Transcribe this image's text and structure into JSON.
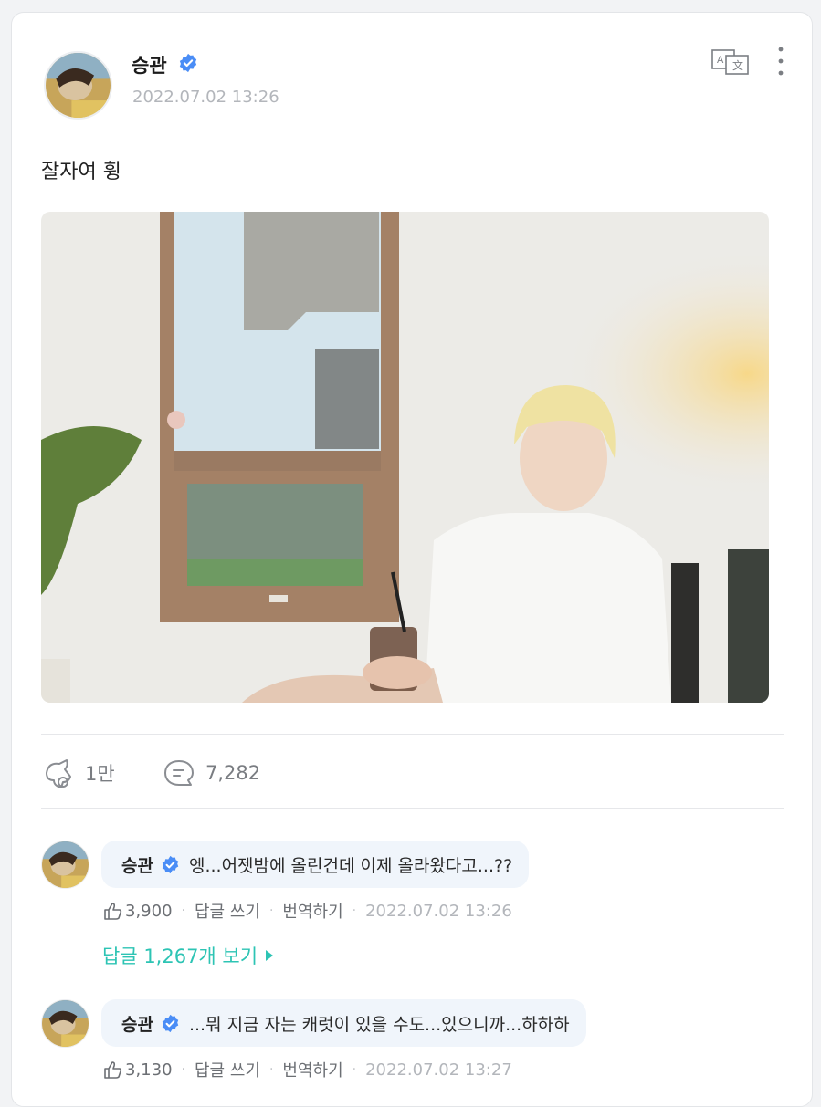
{
  "post": {
    "author": "승관",
    "date": "2022.07.02 13:26",
    "text": "잘자여 휭",
    "stats": {
      "likes": "1만",
      "comments": "7,282"
    }
  },
  "comments": [
    {
      "author": "승관",
      "text": "엥...어젯밤에 올린건데 이제 올라왔다고...??",
      "likes": "3,900",
      "reply_label": "답글 쓰기",
      "translate_label": "번역하기",
      "date": "2022.07.02 13:26",
      "replies_link": "답글 1,267개 보기"
    },
    {
      "author": "승관",
      "text": "...뭐 지금 자는 캐럿이 있을 수도...있으니까...하하하",
      "likes": "3,130",
      "reply_label": "답글 쓰기",
      "translate_label": "번역하기",
      "date": "2022.07.02 13:27"
    }
  ],
  "icons": {
    "verified": "verified-badge-icon",
    "translate": "translate-icon",
    "more": "more-vertical-icon",
    "like": "cheer-like-icon",
    "comment": "comment-icon",
    "thumb": "thumbs-up-icon",
    "replies_arrow": "triangle-right-icon"
  },
  "colors": {
    "verified": "#4a8df6",
    "accent": "#2dc4b4",
    "bubble": "#f0f5fb"
  }
}
